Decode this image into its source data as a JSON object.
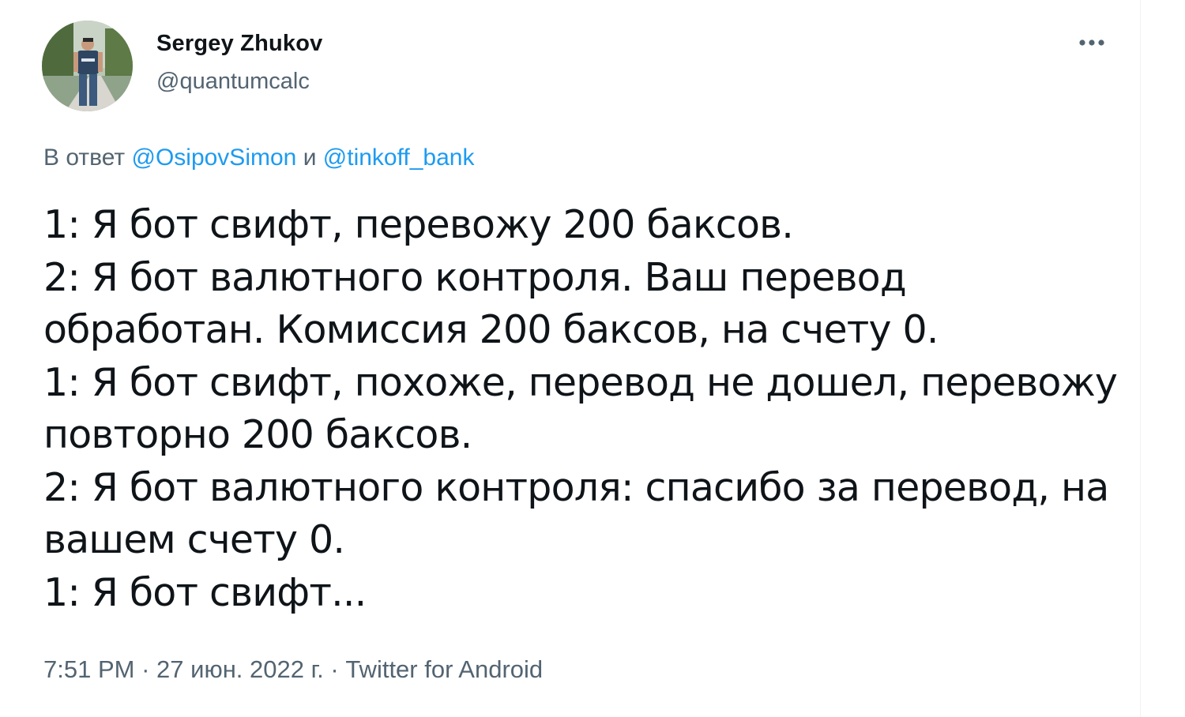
{
  "author": {
    "display_name": "Sergey Zhukov",
    "handle": "@quantumcalc"
  },
  "reply": {
    "prefix": "В ответ",
    "mention_1": "@OsipovSimon",
    "conjunction": "и",
    "mention_2": "@tinkoff_bank"
  },
  "tweet": {
    "lines": [
      "1: Я бот свифт, перевожу 200 баксов.",
      "2: Я бот валютного контроля. Ваш перевод",
      "обработан. Комиссия 200 баксов, на счету 0.",
      "1: Я бот свифт, похоже, перевод не дошел, перевожу",
      "повторно 200 баксов.",
      "2: Я бот валютного контроля: спасибо за перевод, на",
      "вашем счету 0.",
      "1: Я бот свифт..."
    ]
  },
  "meta": {
    "time": "7:51 PM",
    "separator": "·",
    "date": "27 июн. 2022 г.",
    "source": "Twitter for Android"
  },
  "icons": {
    "more": "more-horizontal-icon",
    "avatar": "user-avatar"
  },
  "colors": {
    "text_primary": "#0f1419",
    "text_secondary": "#536471",
    "accent": "#1d9bf0"
  }
}
